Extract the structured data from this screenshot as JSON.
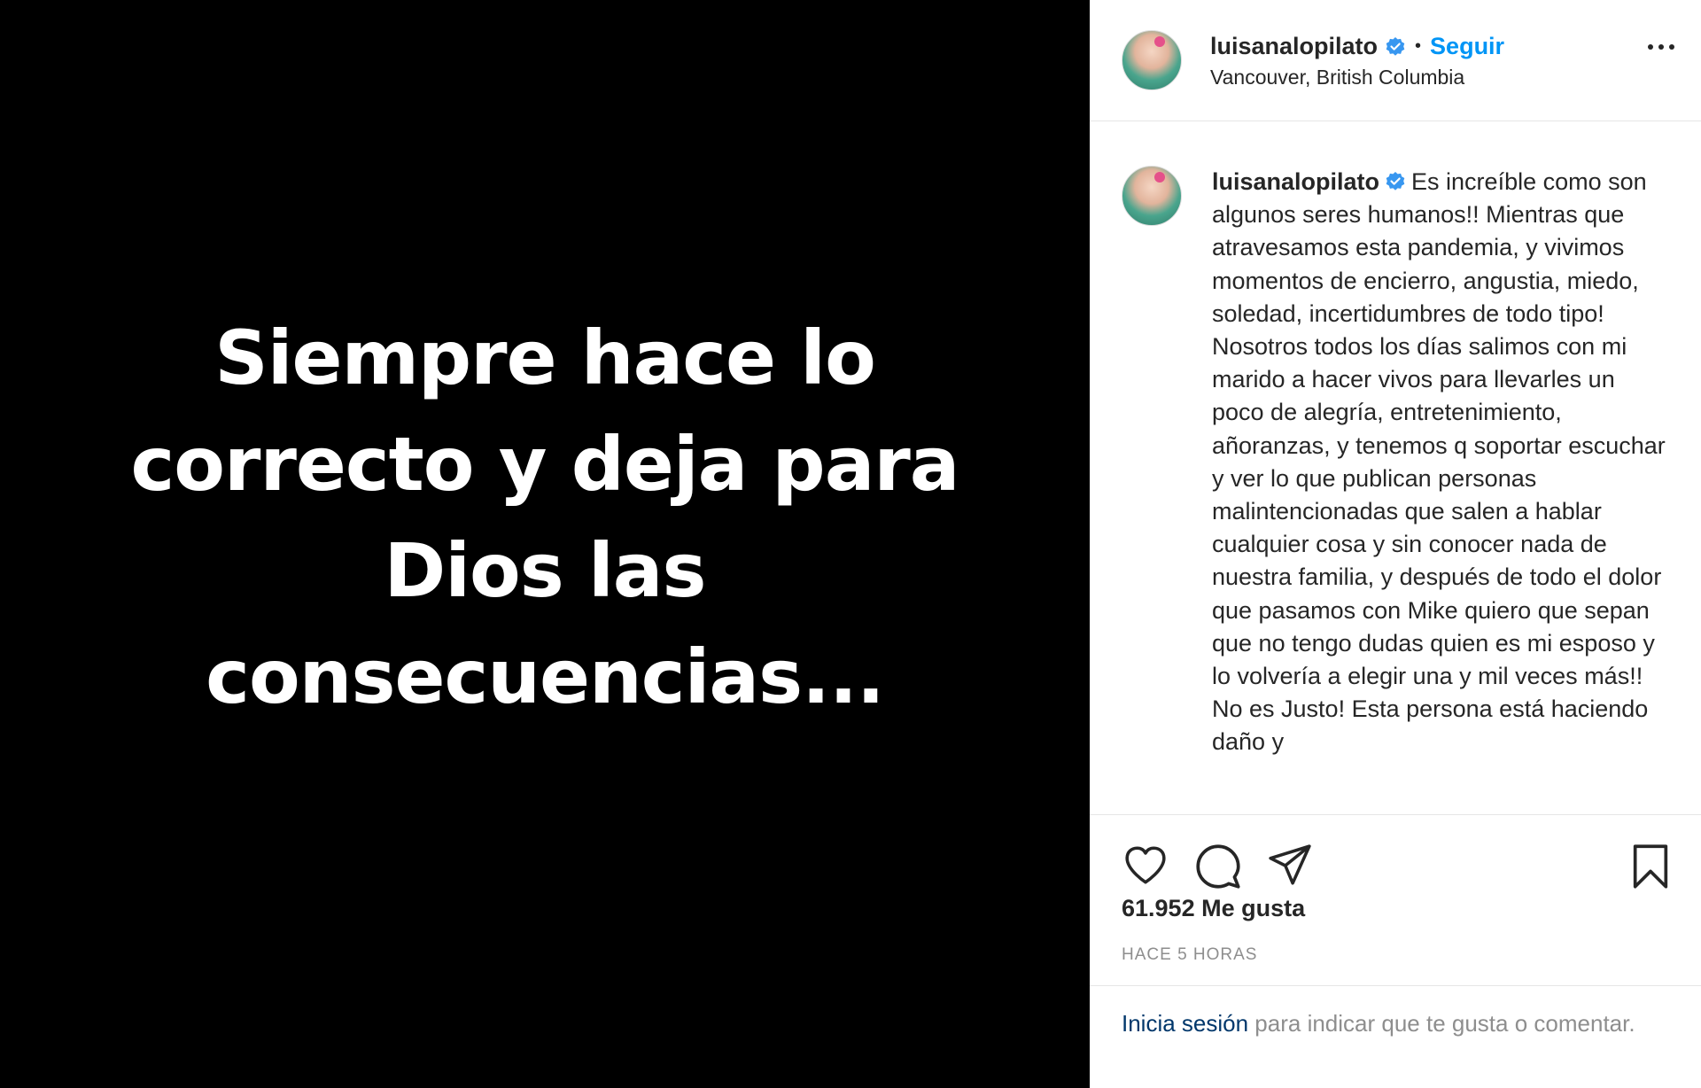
{
  "media": {
    "lines": [
      "Siempre hace lo",
      "correcto y deja para",
      "Dios las",
      "consecuencias..."
    ]
  },
  "header": {
    "username": "luisanalopilato",
    "dot": "•",
    "follow_label": "Seguir",
    "location": "Vancouver, British Columbia"
  },
  "caption": {
    "username": "luisanalopilato",
    "text": "Es increíble como son algunos seres humanos!! Mientras que atravesamos esta pandemia, y vivimos momentos de encierro, angustia, miedo, soledad, incertidumbres de todo tipo! Nosotros todos los días salimos con mi marido a hacer vivos para llevarles un poco de alegría, entretenimiento, añoranzas, y tenemos q soportar escuchar y ver lo que publican personas malintencionadas que salen a hablar cualquier cosa y sin conocer nada de nuestra familia, y después de todo el dolor que pasamos con Mike quiero que sepan que no tengo dudas quien es mi esposo y lo volvería a elegir una y mil veces más!! No es Justo! Esta persona está haciendo daño y"
  },
  "icons": {
    "verified": "verified-badge-icon",
    "like": "heart-icon",
    "comment": "comment-icon",
    "share": "send-icon",
    "save": "bookmark-icon",
    "more": "more-options-icon"
  },
  "stats": {
    "likes": "61.952 Me gusta",
    "time": "HACE 5 HORAS"
  },
  "footer": {
    "login_link": "Inicia sesión",
    "rest": " para indicar que te gusta o comentar."
  },
  "colors": {
    "accent": "#0095f6",
    "verified": "#3897f0",
    "text": "#262626",
    "muted": "#8e8e8e"
  }
}
